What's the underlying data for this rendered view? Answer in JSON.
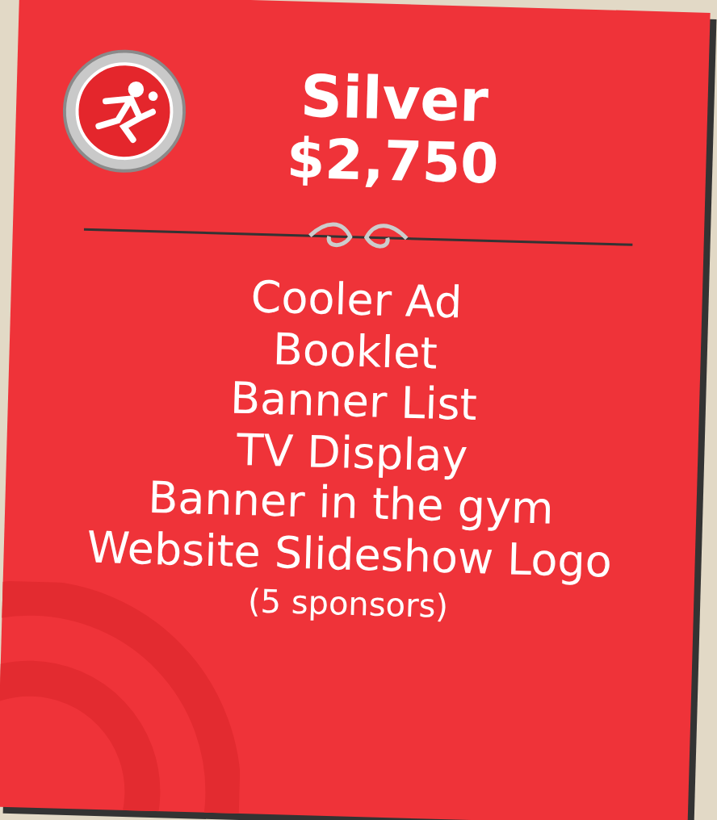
{
  "tier": {
    "title": "Silver",
    "price": "$2,750"
  },
  "benefits": [
    "Cooler Ad",
    "Booklet",
    "Banner List",
    "TV Display",
    "Banner in the gym",
    "Website Slideshow Logo"
  ],
  "note": "(5 sponsors)"
}
